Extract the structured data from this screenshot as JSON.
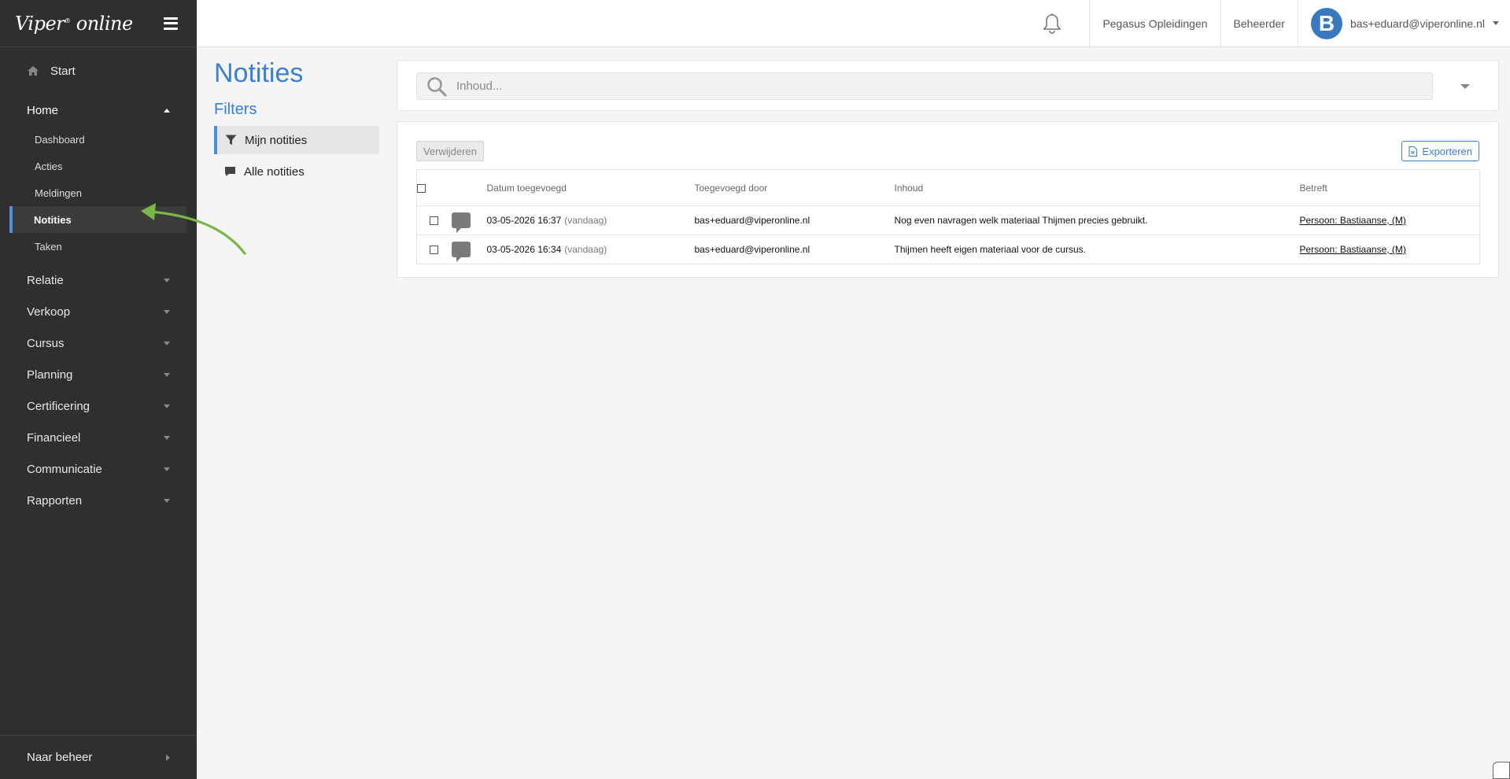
{
  "brand": {
    "logo_text": "Viper",
    "logo_sup": "®",
    "logo_text2": "online"
  },
  "sidebar": {
    "start_label": "Start",
    "home_label": "Home",
    "home_items": [
      {
        "label": "Dashboard"
      },
      {
        "label": "Acties"
      },
      {
        "label": "Meldingen"
      },
      {
        "label": "Notities"
      },
      {
        "label": "Taken"
      }
    ],
    "sections": [
      {
        "label": "Relatie"
      },
      {
        "label": "Verkoop"
      },
      {
        "label": "Cursus"
      },
      {
        "label": "Planning"
      },
      {
        "label": "Certificering"
      },
      {
        "label": "Financieel"
      },
      {
        "label": "Communicatie"
      },
      {
        "label": "Rapporten"
      }
    ],
    "footer_label": "Naar beheer"
  },
  "topbar": {
    "organization": "Pegasus Opleidingen",
    "role": "Beheerder",
    "avatar_letter": "B",
    "user_email": "bas+eduard@viperonline.nl"
  },
  "page": {
    "title": "Notities",
    "filters_title": "Filters",
    "filters": [
      {
        "label": "Mijn notities"
      },
      {
        "label": "Alle notities"
      }
    ]
  },
  "search": {
    "placeholder": "Inhoud..."
  },
  "list": {
    "delete_label": "Verwijderen",
    "export_label": "Exporteren",
    "columns": {
      "date": "Datum toegevoegd",
      "by": "Toegevoegd door",
      "content": "Inhoud",
      "about": "Betreft"
    },
    "rows": [
      {
        "date": "03-05-2026 16:37",
        "relative": "(vandaag)",
        "by": "bas+eduard@viperonline.nl",
        "content": "Nog even navragen welk materiaal Thijmen precies gebruikt.",
        "about": "Persoon: Bastiaanse, (M)"
      },
      {
        "date": "03-05-2026 16:34",
        "relative": "(vandaag)",
        "by": "bas+eduard@viperonline.nl",
        "content": "Thijmen heeft eigen materiaal voor de cursus.",
        "about": "Persoon: Bastiaanse, (M)"
      }
    ]
  },
  "colors": {
    "accent": "#3a7fd2",
    "sidebar_bg": "#2f2f2f",
    "annotation_arrow": "#7ab648"
  }
}
